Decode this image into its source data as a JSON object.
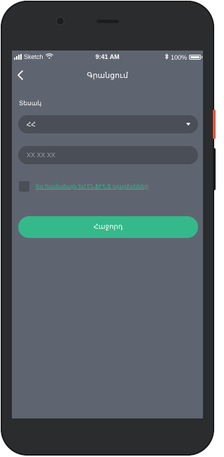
{
  "status_bar": {
    "carrier": "Sketch",
    "time": "9:41 AM",
    "battery": "100%"
  },
  "header": {
    "title": "Գրանցում"
  },
  "form": {
    "country_label": "Տեսակ",
    "country_value": "ՀՀ",
    "phone_placeholder": "XX XX XX",
    "terms_text": "Ես համաձայն եմ ԷՆՖԻՆՏ պայմաններ",
    "terms_checked": false,
    "submit_label": "Հաջորդ"
  },
  "colors": {
    "screen_bg": "#5f6570",
    "field_bg": "#4a4f57",
    "accent": "#35b98a",
    "device_body": "#2b2c2d"
  },
  "icons": {
    "back": "chevron-left-icon",
    "dropdown": "caret-down-icon",
    "wifi": "wifi-icon",
    "bluetooth": "bluetooth-icon",
    "battery": "battery-icon",
    "signal": "signal-icon"
  }
}
